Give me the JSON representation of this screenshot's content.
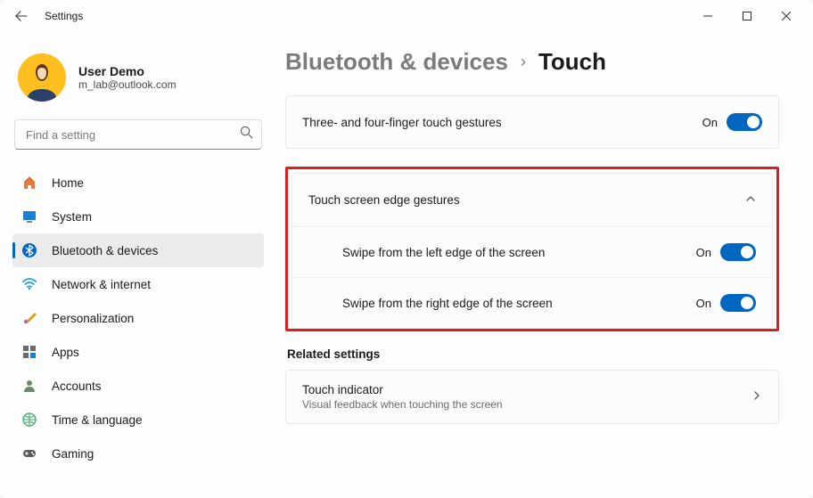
{
  "window": {
    "title": "Settings"
  },
  "user": {
    "name": "User Demo",
    "email": "m_lab@outlook.com"
  },
  "search": {
    "placeholder": "Find a setting"
  },
  "nav": {
    "items": [
      {
        "label": "Home"
      },
      {
        "label": "System"
      },
      {
        "label": "Bluetooth & devices"
      },
      {
        "label": "Network & internet"
      },
      {
        "label": "Personalization"
      },
      {
        "label": "Apps"
      },
      {
        "label": "Accounts"
      },
      {
        "label": "Time & language"
      },
      {
        "label": "Gaming"
      }
    ]
  },
  "breadcrumb": {
    "parent": "Bluetooth & devices",
    "current": "Touch"
  },
  "gestures_card": {
    "label": "Three- and four-finger touch gestures",
    "value": "On"
  },
  "edge_section": {
    "header": "Touch screen edge gestures",
    "left": {
      "label": "Swipe from the left edge of the screen",
      "value": "On"
    },
    "right": {
      "label": "Swipe from the right edge of the screen",
      "value": "On"
    }
  },
  "related": {
    "header": "Related settings",
    "touch_indicator": {
      "title": "Touch indicator",
      "subtitle": "Visual feedback when touching the screen"
    }
  }
}
